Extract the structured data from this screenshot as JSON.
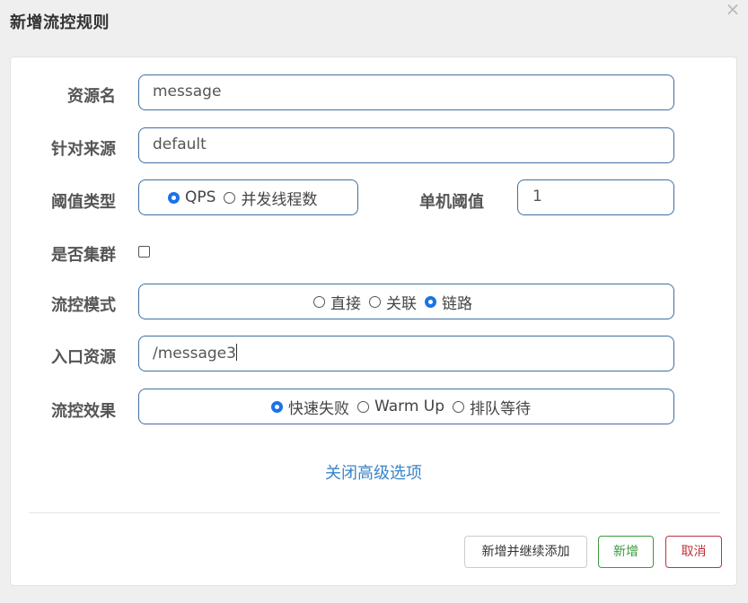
{
  "dialog": {
    "title": "新增流控规则",
    "close_label": "×"
  },
  "form": {
    "resource_name": {
      "label": "资源名",
      "value": "message"
    },
    "limit_app": {
      "label": "针对来源",
      "value": "default"
    },
    "grade": {
      "label": "阈值类型",
      "options": [
        "QPS",
        "并发线程数"
      ],
      "selected": "QPS"
    },
    "count": {
      "label": "单机阈值",
      "value": "1"
    },
    "cluster": {
      "label": "是否集群",
      "checked": false
    },
    "strategy": {
      "label": "流控模式",
      "options": [
        "直接",
        "关联",
        "链路"
      ],
      "selected": "链路"
    },
    "ref_resource": {
      "label": "入口资源",
      "value": "/message3"
    },
    "control_behavior": {
      "label": "流控效果",
      "options": [
        "快速失败",
        "Warm Up",
        "排队等待"
      ],
      "selected": "快速失败"
    },
    "advanced_toggle": "关闭高级选项"
  },
  "footer": {
    "add_continue": "新增并继续添加",
    "add": "新增",
    "cancel": "取消"
  },
  "colors": {
    "field_border": "#3f6fa0",
    "link": "#3a84c7",
    "radio_checked": "#1a73e8",
    "success": "#3a9a3a",
    "danger": "#c0313a"
  }
}
